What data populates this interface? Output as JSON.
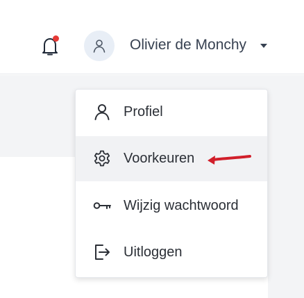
{
  "header": {
    "user_name": "Olivier de Monchy",
    "icons": {
      "notification": "bell-icon",
      "avatar": "user-icon",
      "dropdown": "caret-down-icon"
    },
    "notification_badge_color": "#e53935"
  },
  "menu": {
    "items": [
      {
        "label": "Profiel",
        "icon": "user-icon"
      },
      {
        "label": "Voorkeuren",
        "icon": "gear-icon",
        "highlighted": true
      },
      {
        "label": "Wijzig wachtwoord",
        "icon": "key-icon"
      },
      {
        "label": "Uitloggen",
        "icon": "logout-icon"
      }
    ]
  },
  "annotation": {
    "arrow_color": "#d11f2a",
    "arrow_points_to": "Voorkeuren"
  }
}
